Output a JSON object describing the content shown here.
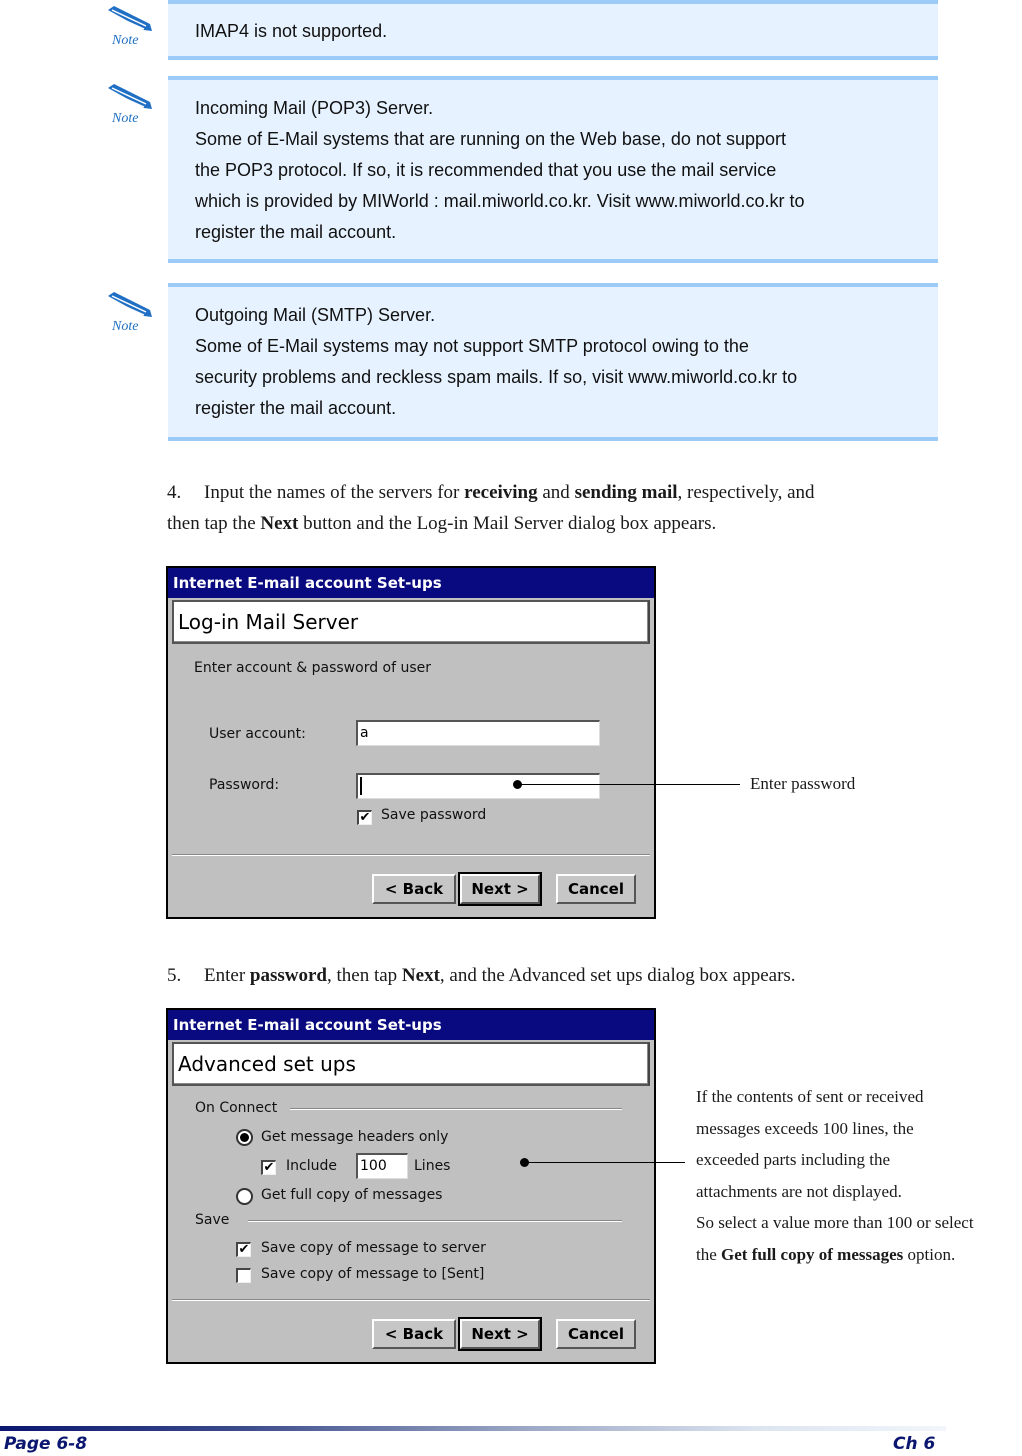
{
  "notes": [
    {
      "icon": "note-pencil-icon",
      "icon_label": "Note",
      "lines": [
        "IMAP4 is not supported."
      ]
    },
    {
      "icon": "note-pencil-icon",
      "icon_label": "Note",
      "lines": [
        "Incoming Mail (POP3) Server.",
        "Some of E-Mail systems that are running on the Web base, do not support",
        "the POP3 protocol. If so, it is recommended that you use the mail service",
        "which is provided by MIWorld : mail.miworld.co.kr. Visit www.miworld.co.kr to",
        "register the mail account."
      ]
    },
    {
      "icon": "note-pencil-icon",
      "icon_label": "Note",
      "lines": [
        "Outgoing Mail (SMTP) Server.",
        "Some of E-Mail systems may not support SMTP protocol owing to the",
        "security problems and reckless spam mails. If so, visit www.miworld.co.kr to",
        "register the mail account."
      ]
    }
  ],
  "step4": {
    "number": "4.",
    "t1": "Input the names of the servers for ",
    "b1": "receiving",
    "t2": " and ",
    "b2": "sending mail",
    "t3": ", respectively, and",
    "t4": "then tap the ",
    "b3": "Next",
    "t5": " button and the Log-in Mail Server dialog box appears."
  },
  "dialog1": {
    "title": "Internet E-mail account Set-ups",
    "header": "Log-in Mail Server",
    "subtitle": "Enter account & password of user",
    "user_label": "User account:",
    "user_value": "a",
    "password_label": "Password:",
    "password_value": "",
    "save_password_label": "Save password",
    "save_password_checked": true,
    "back": "< Back",
    "next": "Next >",
    "cancel": "Cancel",
    "callout": "Enter password"
  },
  "step5": {
    "number": "5.",
    "t1": "Enter ",
    "b1": "password",
    "t2": ", then tap ",
    "b2": "Next",
    "t3": ", and the Advanced set ups dialog box appears."
  },
  "dialog2": {
    "title": "Internet E-mail account Set-ups",
    "header": "Advanced set ups",
    "group_on_connect": "On Connect",
    "radio_headers": "Get message headers only",
    "radio_headers_selected": true,
    "include_label": "Include",
    "include_checked": true,
    "include_value": "100",
    "lines_label": "Lines",
    "radio_full": "Get full copy of messages",
    "radio_full_selected": false,
    "group_save": "Save",
    "save_server": "Save copy of message to server",
    "save_server_checked": true,
    "save_sent": "Save copy of message to [Sent]",
    "save_sent_checked": false,
    "back": "< Back",
    "next": "Next >",
    "cancel": "Cancel",
    "callout": {
      "l1": "If the contents of sent or received",
      "l2": "messages exceeds 100 lines, the",
      "l3": "exceeded parts including the",
      "l4": "attachments are not displayed.",
      "l5": "So select a value more than 100 or select",
      "l6a": "the ",
      "l6b": "Get full copy of messages",
      "l6c": " option."
    }
  },
  "footer": {
    "page": "Page 6-8",
    "chapter": "Ch 6"
  },
  "colors": {
    "note_bg": "#e6f2ff",
    "note_border": "#9ccbf8",
    "dialog_title_bg": "#0a0a80",
    "footer_text": "#0a1670"
  }
}
